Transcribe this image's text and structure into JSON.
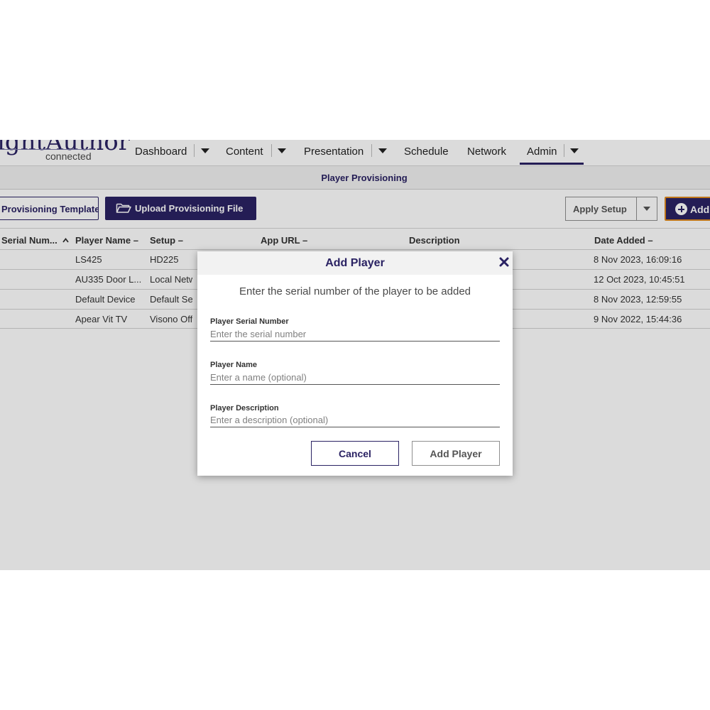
{
  "brand": {
    "logo_text": "ightAuthor",
    "logo_sub": "connected"
  },
  "nav": {
    "dashboard": "Dashboard",
    "content": "Content",
    "presentation": "Presentation",
    "schedule": "Schedule",
    "network": "Network",
    "admin": "Admin",
    "active": "Admin"
  },
  "subbar": {
    "title": "Player Provisioning"
  },
  "toolbar": {
    "template_label": "Provisioning Template",
    "upload_label": "Upload Provisioning File",
    "apply_label": "Apply Setup",
    "add_label": "Add"
  },
  "table": {
    "columns": {
      "serial": "Serial Num...",
      "name": "Player Name",
      "setup": "Setup",
      "app_url": "App URL",
      "description": "Description",
      "date_added": "Date Added"
    },
    "sort_indicator": "^",
    "col_dash": "–",
    "rows": [
      {
        "name": "LS425",
        "setup": "HD225",
        "date": "8 Nov 2023, 16:09:16"
      },
      {
        "name": "AU335 Door L...",
        "setup": "Local Netwo",
        "date": "12 Oct 2023, 10:45:51"
      },
      {
        "name": "Default Device",
        "setup": "Default Setu",
        "date": "8 Nov 2023, 12:59:55"
      },
      {
        "name": "Apear Vit TV",
        "setup": "Visono Offic",
        "date": "9 Nov 2022, 15:44:36"
      }
    ]
  },
  "modal": {
    "title": "Add Player",
    "subtitle": "Enter the serial number of the player to be added",
    "fields": {
      "serial_label": "Player Serial Number",
      "serial_placeholder": "Enter the serial number",
      "serial_value": "",
      "name_label": "Player Name",
      "name_placeholder": "Enter a name (optional)",
      "name_value": "",
      "desc_label": "Player Description",
      "desc_placeholder": "Enter a description (optional)",
      "desc_value": ""
    },
    "cancel_label": "Cancel",
    "submit_label": "Add Player"
  },
  "colors": {
    "brand": "#2a2263",
    "accent_border": "#e08a1e",
    "header_bg": "#f2f2f2"
  },
  "icons": [
    "caret-down-icon",
    "folder-icon",
    "plus-circle-icon",
    "sort-up-icon",
    "close-icon"
  ]
}
